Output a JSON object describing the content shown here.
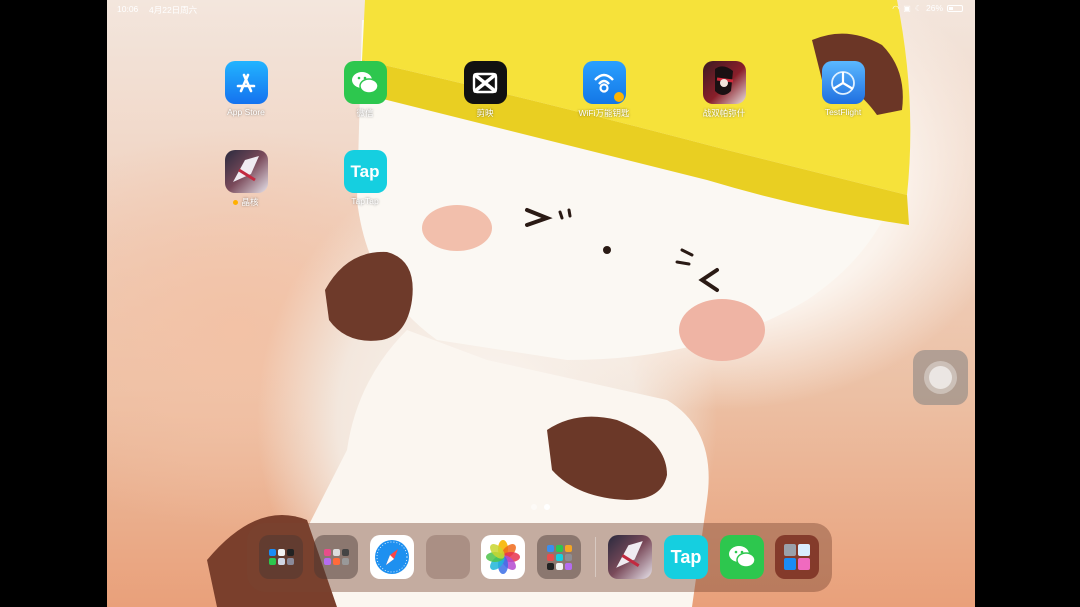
{
  "status": {
    "time": "10:06",
    "date": "4月22日周六",
    "battery": "26%"
  },
  "home_apps": [
    {
      "label": "App Store",
      "icon": "app-store-icon"
    },
    {
      "label": "微信",
      "icon": "wechat-icon"
    },
    {
      "label": "剪映",
      "icon": "capcut-icon"
    },
    {
      "label": "WiFi万能钥匙",
      "icon": "wifi-key-icon"
    },
    {
      "label": "战双帕弥什",
      "icon": "punishing-gray-raven-icon"
    },
    {
      "label": "TestFlight",
      "icon": "testflight-icon"
    },
    {
      "label": "晶核",
      "icon": "crystal-core-icon"
    },
    {
      "label": "TapTap",
      "icon": "taptap-icon"
    }
  ],
  "taptap_glyph": "Tap",
  "dock": {
    "apps": [
      "folder-icon",
      "folder-icon",
      "safari-icon",
      "empty-folder-icon",
      "photos-icon",
      "folder-icon",
      "crystal-core-icon",
      "taptap-icon",
      "wechat-icon",
      "folder-icon"
    ]
  },
  "page_indicator": {
    "pages": 2,
    "current": 2
  },
  "colors": {
    "headband": "#f5e02f",
    "app_store": "#1a8cf5",
    "wechat": "#2dc74e",
    "taptap": "#1ad0e0",
    "wifi_key": "#1c8ff0"
  }
}
